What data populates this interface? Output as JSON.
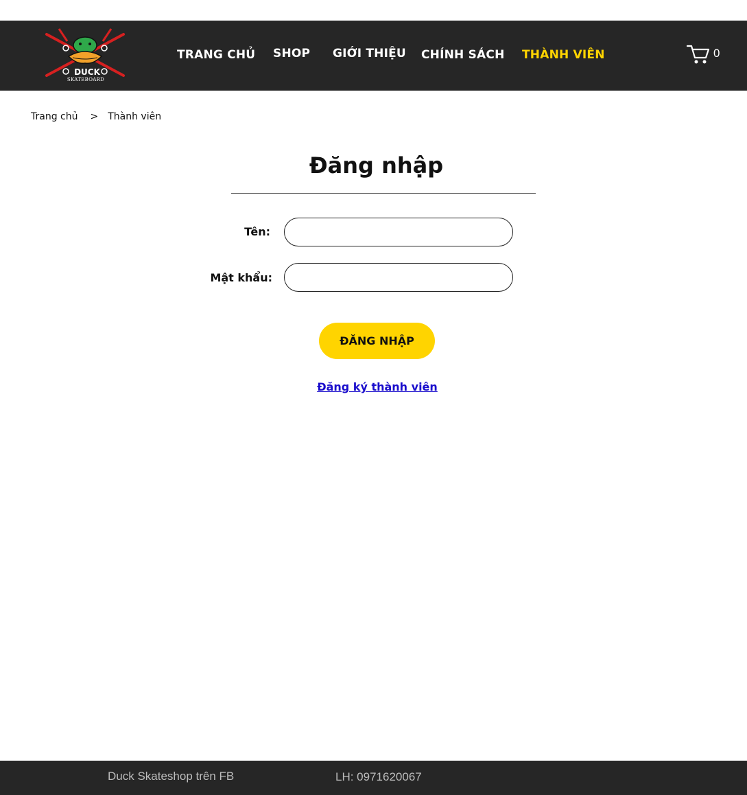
{
  "nav": {
    "logo_text": "DUCK",
    "logo_subtext": "SKATEBOARD",
    "items": [
      {
        "label": "TRANG CHỦ"
      },
      {
        "label": "SHOP"
      },
      {
        "label": "GIỚI THIỆU"
      },
      {
        "label": "CHÍNH SÁCH"
      },
      {
        "label": "THÀNH VIÊN",
        "active": true
      }
    ],
    "cart_count": "0",
    "accent_color": "#ffd400",
    "bar_color": "#262626"
  },
  "breadcrumb": {
    "home": "Trang chủ",
    "separator": ">",
    "current": "Thành viên"
  },
  "login": {
    "title": "Đăng nhập",
    "name_label": "Tên:",
    "name_value": "",
    "password_label": "Mật khẩu:",
    "password_value": "",
    "submit_label": "ĐĂNG NHẬP",
    "register_link": "Đăng ký thành viên"
  },
  "footer": {
    "facebook_text": "Duck Skateshop trên FB",
    "phone_text": "LH: 0971620067"
  }
}
